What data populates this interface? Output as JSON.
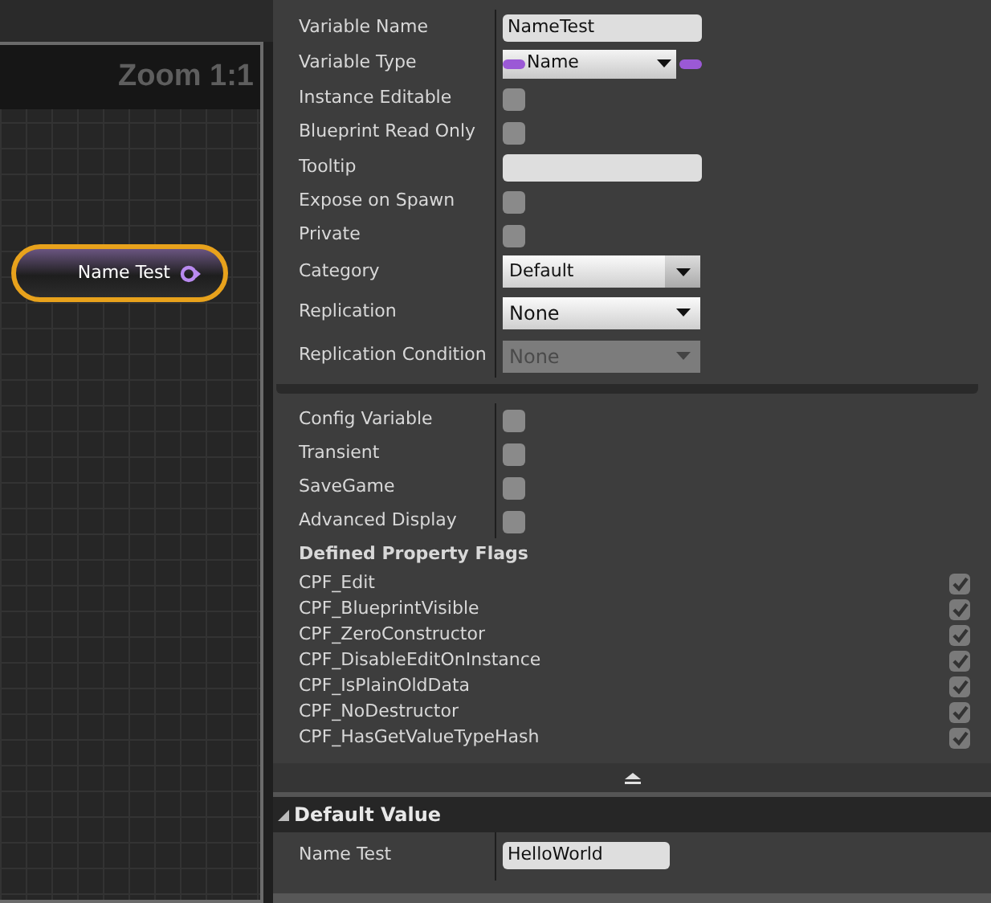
{
  "graph": {
    "zoom_label": "Zoom 1:1",
    "node": {
      "title": "Name Test",
      "selected": true
    }
  },
  "details": {
    "rows": [
      {
        "kind": "text",
        "label": "Variable Name",
        "value": "NameTest"
      },
      {
        "kind": "type",
        "label": "Variable Type",
        "value": "Name"
      },
      {
        "kind": "checkbox",
        "label": "Instance Editable",
        "checked": false
      },
      {
        "kind": "checkbox",
        "label": "Blueprint Read Only",
        "checked": false
      },
      {
        "kind": "text",
        "label": "Tooltip"
      },
      {
        "kind": "checkbox",
        "label": "Expose on Spawn",
        "checked": false
      },
      {
        "kind": "checkbox",
        "label": "Private",
        "checked": false
      },
      {
        "kind": "combo",
        "label": "Category",
        "value": "Default",
        "disabled": false
      },
      {
        "kind": "dropdown",
        "label": "Replication",
        "value": "None",
        "disabled": false
      },
      {
        "kind": "dropdown",
        "label": "Replication Condition",
        "value": "None",
        "disabled": true
      }
    ],
    "advanced_rows": [
      {
        "label": "Config Variable",
        "checked": false
      },
      {
        "label": "Transient",
        "checked": false
      },
      {
        "label": "SaveGame",
        "checked": false
      },
      {
        "label": "Advanced Display",
        "checked": false
      }
    ],
    "flags_title": "Defined Property Flags",
    "flags": [
      {
        "label": "CPF_Edit",
        "checked": true
      },
      {
        "label": "CPF_BlueprintVisible",
        "checked": true
      },
      {
        "label": "CPF_ZeroConstructor",
        "checked": true
      },
      {
        "label": "CPF_DisableEditOnInstance",
        "checked": true
      },
      {
        "label": "CPF_IsPlainOldData",
        "checked": true
      },
      {
        "label": "CPF_NoDestructor",
        "checked": true
      },
      {
        "label": "CPF_HasGetValueTypeHash",
        "checked": true
      }
    ]
  },
  "default_value": {
    "title": "Default Value",
    "expanded": true,
    "rows": [
      {
        "label": "Name Test",
        "value": "HelloWorld"
      }
    ]
  }
}
